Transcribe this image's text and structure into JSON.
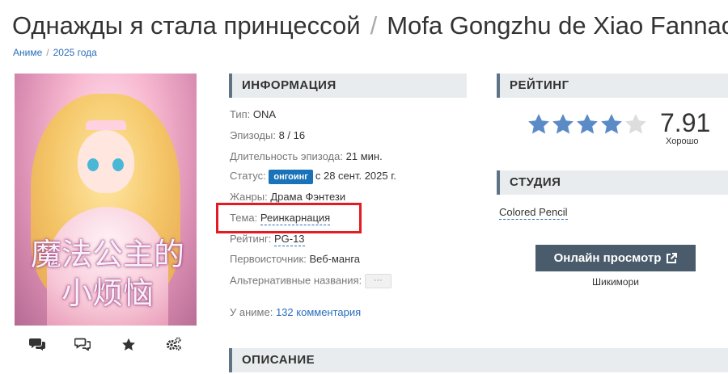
{
  "header": {
    "title_ru": "Однажды я стала принцессой",
    "separator": "/",
    "title_romaji": "Mofa Gongzhu de Xiao Fannao"
  },
  "breadcrumb": {
    "items": [
      "Аниме",
      "2025 года"
    ],
    "separator": "/"
  },
  "poster": {
    "title_cn_line1": "魔法公主的",
    "title_cn_line2": "小烦恼"
  },
  "actions": {
    "icons": [
      "comments-icon",
      "discussion-icon",
      "favorite-star-icon",
      "settings-gears-icon"
    ]
  },
  "info": {
    "heading": "ИНФОРМАЦИЯ",
    "type_label": "Тип:",
    "type_value": "ONA",
    "episodes_label": "Эпизоды:",
    "episodes_value": "8 / 16",
    "duration_label": "Длительность эпизода:",
    "duration_value": "21 мин.",
    "status_label": "Статус:",
    "status_badge": "онгоинг",
    "status_value": "с 28 сент. 2025 г.",
    "genres_label": "Жанры:",
    "genres": [
      "Драма",
      "Фэнтези"
    ],
    "theme_label": "Тема:",
    "theme_value": "Реинкарнация",
    "rating_label": "Рейтинг:",
    "rating_value": "PG-13",
    "source_label": "Первоисточник:",
    "source_value": "Веб-манга",
    "alt_names_label": "Альтернативные названия:",
    "alt_names_button": "···",
    "comments_label": "У аниме:",
    "comments_value": "132 комментария"
  },
  "rating": {
    "heading": "РЕЙТИНГ",
    "score": "7.91",
    "score_label": "Хорошо",
    "stars_filled": 4,
    "stars_total": 5
  },
  "studio": {
    "heading": "СТУДИЯ",
    "name": "Colored Pencil"
  },
  "watch": {
    "button_label": "Онлайн просмотр",
    "provider": "Шикимори"
  },
  "description": {
    "heading": "ОПИСАНИЕ"
  },
  "colors": {
    "link": "#2a6ebb",
    "badge": "#1a73b8",
    "star": "#5b8bc6",
    "star_empty": "#dddddd",
    "highlight": "#e31b23",
    "button": "#4a5c6b"
  }
}
